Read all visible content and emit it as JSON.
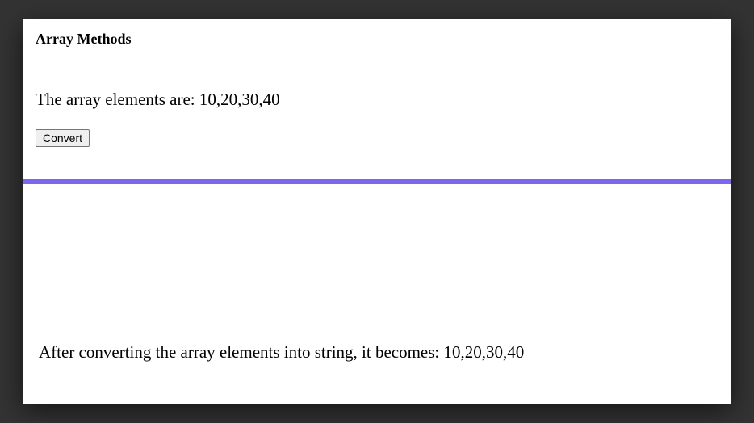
{
  "heading": "Array Methods",
  "array_display": "The array elements are: 10,20,30,40",
  "convert_label": "Convert",
  "result_display": "After converting the array elements into string, it becomes: 10,20,30,40"
}
